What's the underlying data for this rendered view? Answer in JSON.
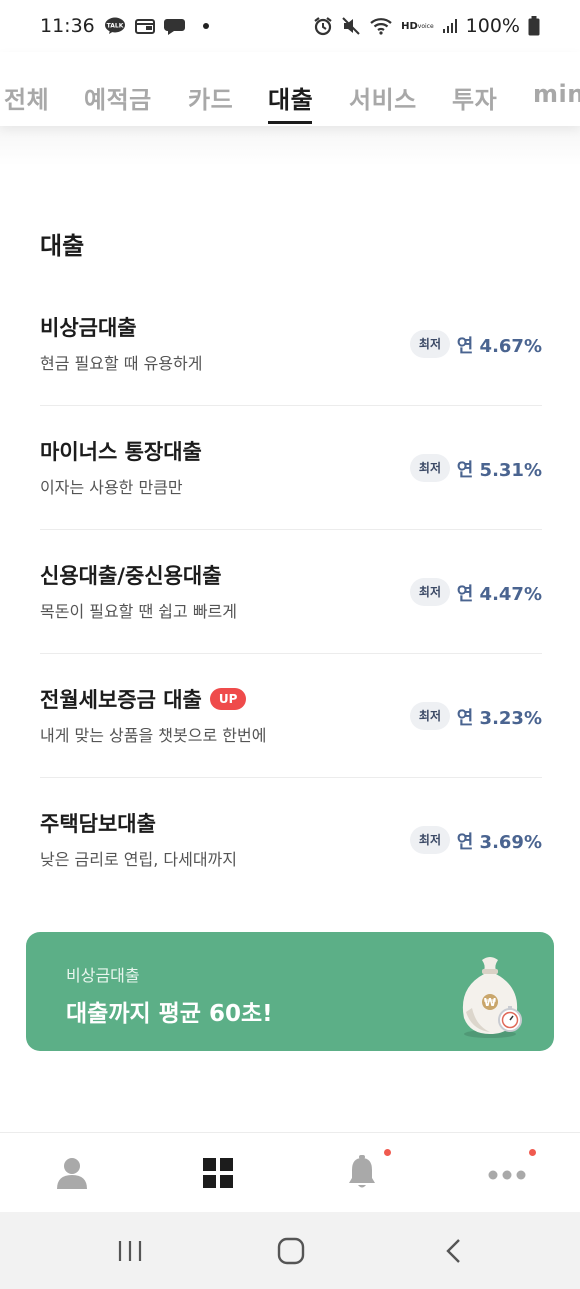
{
  "status_bar": {
    "time": "11:36",
    "battery": "100%"
  },
  "tabs": [
    {
      "label": "전체",
      "active": false
    },
    {
      "label": "예적금",
      "active": false
    },
    {
      "label": "카드",
      "active": false
    },
    {
      "label": "대출",
      "active": true
    },
    {
      "label": "서비스",
      "active": false
    },
    {
      "label": "투자",
      "active": false
    },
    {
      "label": "mini",
      "active": false
    }
  ],
  "section": {
    "title": "대출"
  },
  "loans": [
    {
      "name": "비상금대출",
      "desc": "현금 필요할 때 유용하게",
      "badge": "최저",
      "rate": "연 4.67%"
    },
    {
      "name": "마이너스 통장대출",
      "desc": "이자는 사용한 만큼만",
      "badge": "최저",
      "rate": "연 5.31%"
    },
    {
      "name": "신용대출/중신용대출",
      "desc": "목돈이 필요할 땐 쉽고 빠르게",
      "badge": "최저",
      "rate": "연 4.47%"
    },
    {
      "name": "전월세보증금 대출",
      "tag": "UP",
      "desc": "내게 맞는 상품을 챗봇으로 한번에",
      "badge": "최저",
      "rate": "연 3.23%"
    },
    {
      "name": "주택담보대출",
      "desc": "낮은 금리로 연립, 다세대까지",
      "badge": "최저",
      "rate": "연 3.69%"
    }
  ],
  "promo": {
    "subtitle": "비상금대출",
    "title": "대출까지 평균 60초!",
    "color": "#5caf87"
  },
  "bottom_nav": [
    {
      "icon": "person-icon",
      "active": false,
      "notification": false
    },
    {
      "icon": "grid-icon",
      "active": true,
      "notification": false
    },
    {
      "icon": "bell-icon",
      "active": false,
      "notification": true
    },
    {
      "icon": "more-dots-icon",
      "active": false,
      "notification": true
    }
  ],
  "colors": {
    "rate": "#4a6490",
    "up_badge": "#ef4b4b",
    "notification": "#f05a4f"
  }
}
